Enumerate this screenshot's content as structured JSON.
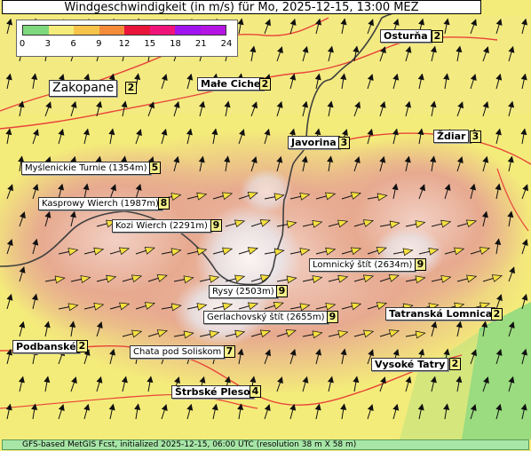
{
  "title": "Windgeschwindigkeit (in m/s) für Mo, 2025-12-15, 13:00 MEZ",
  "footer": "GFS-based MetGIS Fcst, initialized 2025-12-15, 06:00 UTC  (resolution 38 m X 58 m)",
  "legend": {
    "ticks": [
      "0",
      "3",
      "6",
      "9",
      "12",
      "15",
      "18",
      "21",
      "24"
    ],
    "colors": [
      "#7ed87e",
      "#f4ec7a",
      "#f6c44a",
      "#f48c3a",
      "#e8143a",
      "#f0147a",
      "#a014f0",
      "#b414e4"
    ]
  },
  "places": [
    {
      "name": "Osturňa",
      "value": "2"
    },
    {
      "name": "Zakopane",
      "value": "2"
    },
    {
      "name": "Małe Ciche",
      "value": "2"
    },
    {
      "name": "Javorina",
      "value": "3"
    },
    {
      "name": "Ždiar",
      "value": "3"
    },
    {
      "name": "Myślenickie Turnie (1354m)",
      "value": "5"
    },
    {
      "name": "Kasprowy Wierch (1987m)",
      "value": "8"
    },
    {
      "name": "Kozi Wierch (2291m)",
      "value": "9"
    },
    {
      "name": "Lomnický štít (2634m)",
      "value": "9"
    },
    {
      "name": "Rysy (2503m)",
      "value": "9"
    },
    {
      "name": "Gerlachovský štít (2655m)",
      "value": "9"
    },
    {
      "name": "Tatranská Lomnica",
      "value": "2"
    },
    {
      "name": "Podbanské",
      "value": "2"
    },
    {
      "name": "Chata pod Soliskom",
      "value": "7"
    },
    {
      "name": "Vysoké Tatry",
      "value": "2"
    },
    {
      "name": "Štrbské Pleso",
      "value": "4"
    }
  ]
}
